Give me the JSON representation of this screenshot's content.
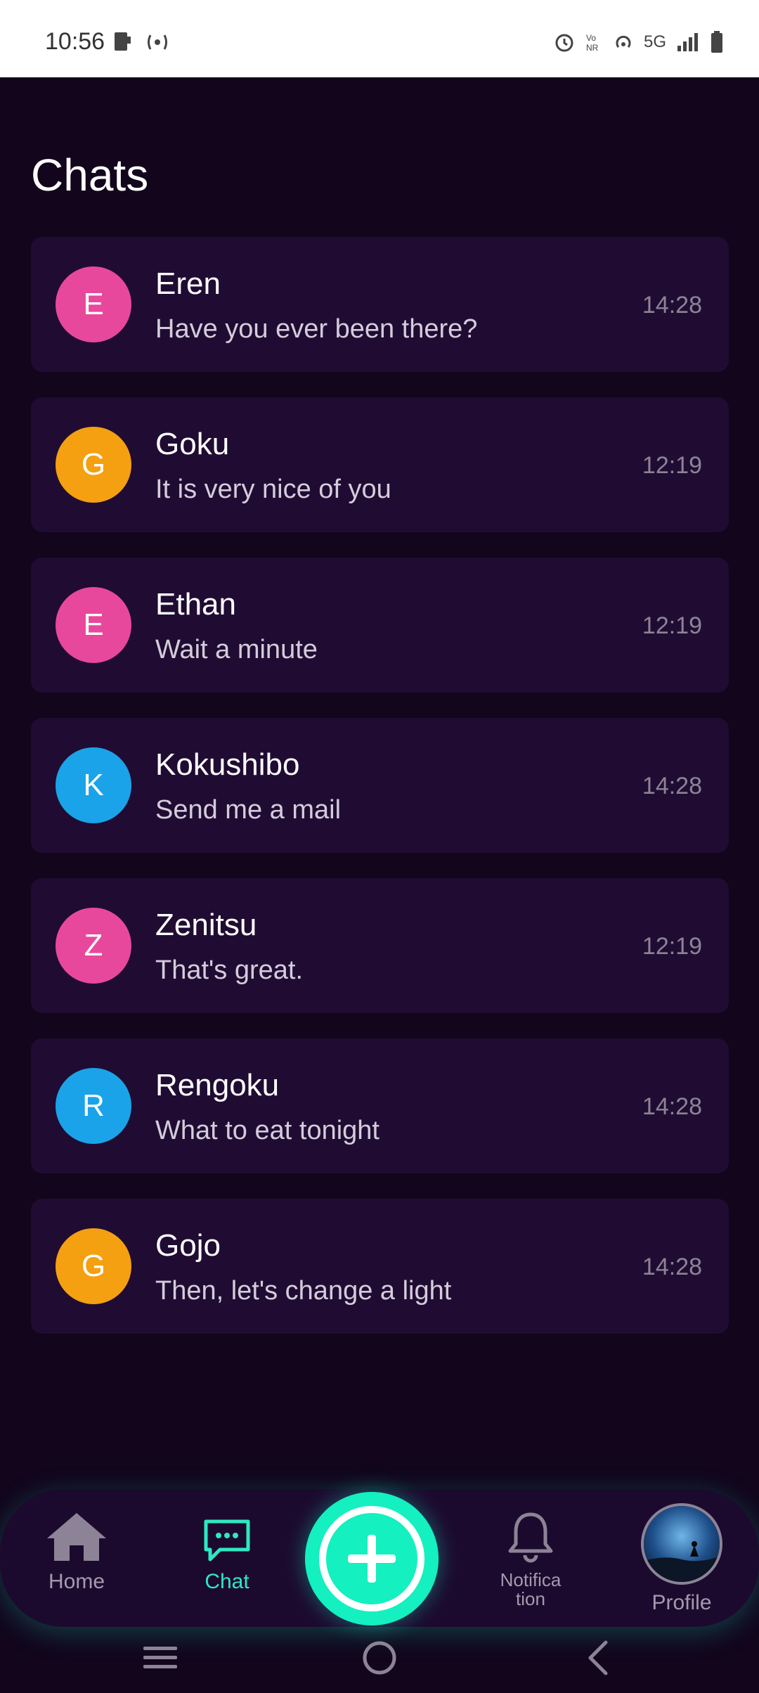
{
  "status_bar": {
    "time": "10:56",
    "network": "5G"
  },
  "page": {
    "title": "Chats"
  },
  "chats": [
    {
      "initial": "E",
      "name": "Eren",
      "message": "Have you ever been there?",
      "time": "14:28",
      "color": "#e8489c"
    },
    {
      "initial": "G",
      "name": "Goku",
      "message": "It is very nice of you",
      "time": "12:19",
      "color": "#f4a011"
    },
    {
      "initial": "E",
      "name": "Ethan",
      "message": "Wait a minute",
      "time": "12:19",
      "color": "#e8489c"
    },
    {
      "initial": "K",
      "name": "Kokushibo",
      "message": "Send me a mail",
      "time": "14:28",
      "color": "#1aa3e8"
    },
    {
      "initial": "Z",
      "name": "Zenitsu",
      "message": "That's great.",
      "time": "12:19",
      "color": "#e8489c"
    },
    {
      "initial": "R",
      "name": "Rengoku",
      "message": "What to eat tonight",
      "time": "14:28",
      "color": "#1aa3e8"
    },
    {
      "initial": "G",
      "name": "Gojo",
      "message": "Then, let's change a light",
      "time": "14:28",
      "color": "#f4a011"
    }
  ],
  "nav": {
    "home": "Home",
    "chat": "Chat",
    "notification": "Notification",
    "profile": "Profile"
  },
  "colors": {
    "accent": "#14f0c0",
    "background": "#12051c",
    "card": "#200c32"
  }
}
